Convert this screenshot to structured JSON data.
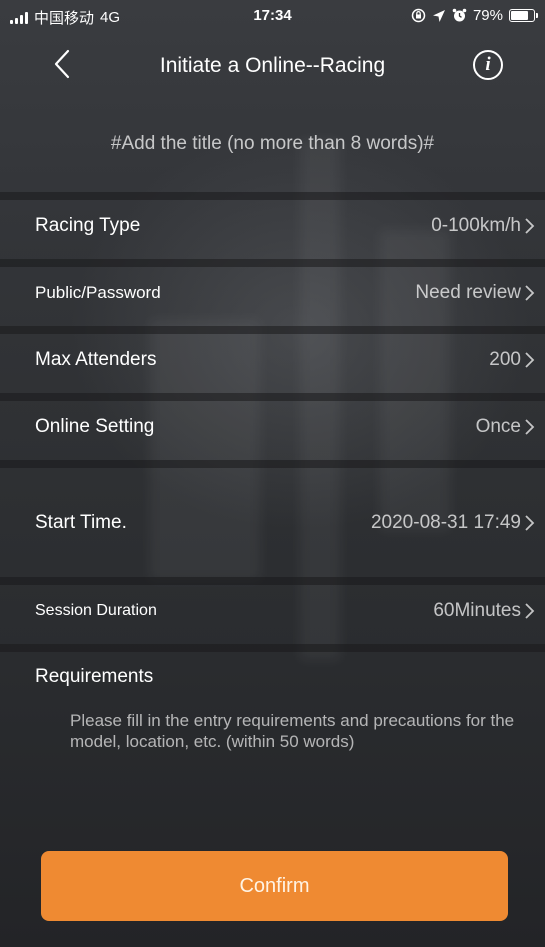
{
  "status_bar": {
    "carrier": "中国移动",
    "network": "4G",
    "time": "17:34",
    "battery": "79%",
    "battery_level": 0.79
  },
  "nav": {
    "title": "Initiate a Online--Racing",
    "back_icon": "chevron-left-icon",
    "info_icon": "info-icon",
    "info_glyph": "i"
  },
  "form": {
    "title_placeholder": "#Add the title (no more than 8 words)#",
    "rows": [
      {
        "label": "Racing Type",
        "value": "0-100km/h"
      },
      {
        "label": "Public/Password",
        "value": "Need review"
      },
      {
        "label": "Max Attenders",
        "value": "200"
      },
      {
        "label": "Online Setting",
        "value": "Once"
      },
      {
        "label": "Start Time.",
        "value": "2020-08-31 17:49"
      },
      {
        "label": "Session Duration",
        "value": "60Minutes"
      }
    ],
    "requirements_label": "Requirements",
    "requirements_placeholder": "Please fill in the entry requirements and precautions for the model, location, etc. (within 50 words)"
  },
  "confirm_label": "Confirm",
  "colors": {
    "accent": "#ef8a32",
    "background": "#2f3134"
  }
}
